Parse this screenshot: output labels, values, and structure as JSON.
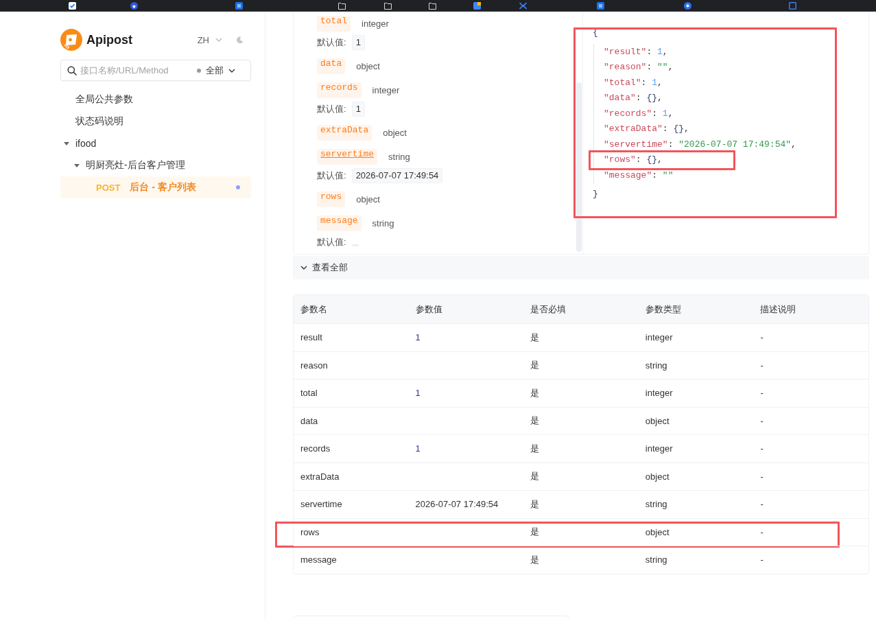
{
  "sidebar": {
    "brand": "Apipost",
    "language": {
      "label": "ZH",
      "expanded": false
    },
    "search": {
      "placeholder": "接口名称/URL/Method",
      "filter": {
        "label": "全部",
        "expanded": false
      }
    },
    "tree": [
      {
        "kind": "doc",
        "label": "全局公共参数",
        "selected": false
      },
      {
        "kind": "doc",
        "label": "状态码说明",
        "selected": false
      },
      {
        "kind": "folder",
        "label": "ifood",
        "expanded": true,
        "selected": false,
        "children": [
          {
            "kind": "folder",
            "label": "明厨亮灶-后台客户管理",
            "expanded": true,
            "selected": false,
            "children": [
              {
                "kind": "api",
                "method": "POST",
                "label": "后台 - 客户列表",
                "selected": true
              }
            ]
          }
        ]
      }
    ]
  },
  "params": [
    {
      "name": "total",
      "type": "integer",
      "underlined": false,
      "default_label": "默认值:",
      "default": "1"
    },
    {
      "name": "data",
      "type": "object",
      "underlined": false
    },
    {
      "name": "records",
      "type": "integer",
      "underlined": false,
      "default_label": "默认值:",
      "default": "1"
    },
    {
      "name": "extraData",
      "type": "object",
      "underlined": false
    },
    {
      "name": "servertime",
      "type": "string",
      "underlined": true,
      "default_label": "默认值:",
      "default": "2026-07-07 17:49:54"
    },
    {
      "name": "rows",
      "type": "object",
      "underlined": false
    },
    {
      "name": "message",
      "type": "string",
      "underlined": false,
      "default_label": "默认值:"
    }
  ],
  "response_example": {
    "highlighted": true,
    "open": "{",
    "close": "}",
    "lines": [
      {
        "highlighted": false,
        "tokens": [
          {
            "kind": "key",
            "text": "\"result\""
          },
          {
            "kind": "punct",
            "text": ": "
          },
          {
            "kind": "number",
            "text": "1"
          },
          {
            "kind": "punct",
            "text": ","
          }
        ]
      },
      {
        "highlighted": false,
        "tokens": [
          {
            "kind": "key",
            "text": "\"reason\""
          },
          {
            "kind": "punct",
            "text": ": "
          },
          {
            "kind": "string",
            "text": "\"\""
          },
          {
            "kind": "punct",
            "text": ","
          }
        ]
      },
      {
        "highlighted": false,
        "tokens": [
          {
            "kind": "key",
            "text": "\"total\""
          },
          {
            "kind": "punct",
            "text": ": "
          },
          {
            "kind": "number",
            "text": "1"
          },
          {
            "kind": "punct",
            "text": ","
          }
        ]
      },
      {
        "highlighted": false,
        "tokens": [
          {
            "kind": "key",
            "text": "\"data\""
          },
          {
            "kind": "punct",
            "text": ": "
          },
          {
            "kind": "brace",
            "text": "{}"
          },
          {
            "kind": "punct",
            "text": ","
          }
        ]
      },
      {
        "highlighted": false,
        "tokens": [
          {
            "kind": "key",
            "text": "\"records\""
          },
          {
            "kind": "punct",
            "text": ": "
          },
          {
            "kind": "number",
            "text": "1"
          },
          {
            "kind": "punct",
            "text": ","
          }
        ]
      },
      {
        "highlighted": false,
        "tokens": [
          {
            "kind": "key",
            "text": "\"extraData\""
          },
          {
            "kind": "punct",
            "text": ": "
          },
          {
            "kind": "brace",
            "text": "{}"
          },
          {
            "kind": "punct",
            "text": ","
          }
        ]
      },
      {
        "highlighted": false,
        "tokens": [
          {
            "kind": "key",
            "text": "\"servertime\""
          },
          {
            "kind": "punct",
            "text": ": "
          },
          {
            "kind": "string",
            "text": "\"2026-07-07 17:49:54\""
          },
          {
            "kind": "punct",
            "text": ","
          }
        ]
      },
      {
        "highlighted": true,
        "tokens": [
          {
            "kind": "key",
            "text": "\"rows\""
          },
          {
            "kind": "punct",
            "text": ": "
          },
          {
            "kind": "brace",
            "text": "{}"
          },
          {
            "kind": "punct",
            "text": ","
          }
        ]
      },
      {
        "highlighted": false,
        "tokens": [
          {
            "kind": "key",
            "text": "\"message\""
          },
          {
            "kind": "punct",
            "text": ": "
          },
          {
            "kind": "string",
            "text": "\"\""
          }
        ]
      }
    ]
  },
  "expand_toggle": {
    "label": "查看全部",
    "expanded": false
  },
  "table": {
    "columns": [
      "参数名",
      "参数值",
      "是否必填",
      "参数类型",
      "描述说明"
    ],
    "rows": [
      {
        "name": "result",
        "value": "1",
        "required": "是",
        "type": "integer",
        "description": "-",
        "highlighted": false
      },
      {
        "name": "reason",
        "required": "是",
        "type": "string",
        "description": "-",
        "highlighted": false
      },
      {
        "name": "total",
        "value": "1",
        "required": "是",
        "type": "integer",
        "description": "-",
        "highlighted": false
      },
      {
        "name": "data",
        "required": "是",
        "type": "object",
        "description": "-",
        "highlighted": false
      },
      {
        "name": "records",
        "value": "1",
        "required": "是",
        "type": "integer",
        "description": "-",
        "highlighted": false
      },
      {
        "name": "extraData",
        "required": "是",
        "type": "object",
        "description": "-",
        "highlighted": false
      },
      {
        "name": "servertime",
        "value": "2026-07-07 17:49:54",
        "required": "是",
        "type": "string",
        "description": "-",
        "highlighted": false
      },
      {
        "name": "rows",
        "required": "是",
        "type": "object",
        "description": "-",
        "highlighted": true
      },
      {
        "name": "message",
        "required": "是",
        "type": "string",
        "description": "-",
        "highlighted": false
      }
    ]
  }
}
